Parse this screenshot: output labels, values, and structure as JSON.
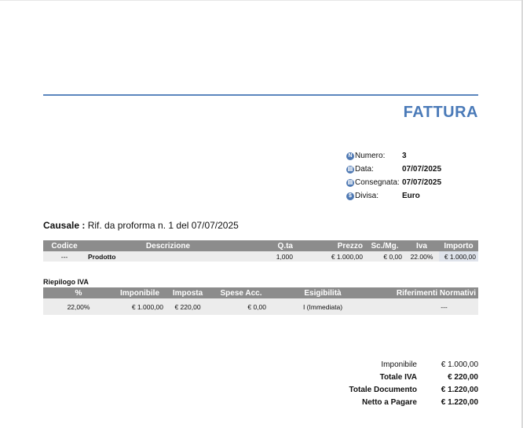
{
  "title": "FATTURA",
  "meta": [
    {
      "icon": "number-icon",
      "glyph": "N",
      "label": "Numero:",
      "value": "3"
    },
    {
      "icon": "calendar-icon",
      "glyph": "▤",
      "label": "Data:",
      "value": "07/07/2025"
    },
    {
      "icon": "delivery-icon",
      "glyph": "▤",
      "label": "Consegnata:",
      "value": "07/07/2025"
    },
    {
      "icon": "currency-icon",
      "glyph": "$",
      "label": "Divisa:",
      "value": "Euro"
    }
  ],
  "causale": {
    "label": "Causale :",
    "text": " Rif. da proforma n. 1 del 07/07/2025"
  },
  "items": {
    "headers": [
      "Codice",
      "Descrizione",
      "Q.ta",
      "Prezzo",
      "Sc./Mg.",
      "Iva",
      "Importo"
    ],
    "rows": [
      {
        "codice": "---",
        "descrizione": "Prodotto",
        "qta": "1,000",
        "prezzo": "€ 1.000,00",
        "sconto": "€ 0,00",
        "iva": "22.00%",
        "importo": "€ 1.000,00"
      }
    ]
  },
  "riepilogo": {
    "title": "Riepilogo IVA",
    "headers": [
      "%",
      "Imponibile",
      "Imposta",
      "Spese Acc.",
      "Esigibilità",
      "Riferimenti Normativi"
    ],
    "rows": [
      {
        "perc": "22,00%",
        "imponibile": "€ 1.000,00",
        "imposta": "€ 220,00",
        "spese": "€ 0,00",
        "esigibilita": "I (Immediata)",
        "riferimenti": "---"
      }
    ]
  },
  "totals": [
    {
      "label": "Imponibile",
      "value": "€ 1.000,00",
      "bold": false
    },
    {
      "label": "Totale IVA",
      "value": "€ 220,00",
      "bold": true
    },
    {
      "label": "Totale Documento",
      "value": "€ 1.220,00",
      "bold": true
    },
    {
      "label": "Netto a Pagare",
      "value": "€ 1.220,00",
      "bold": true
    }
  ]
}
